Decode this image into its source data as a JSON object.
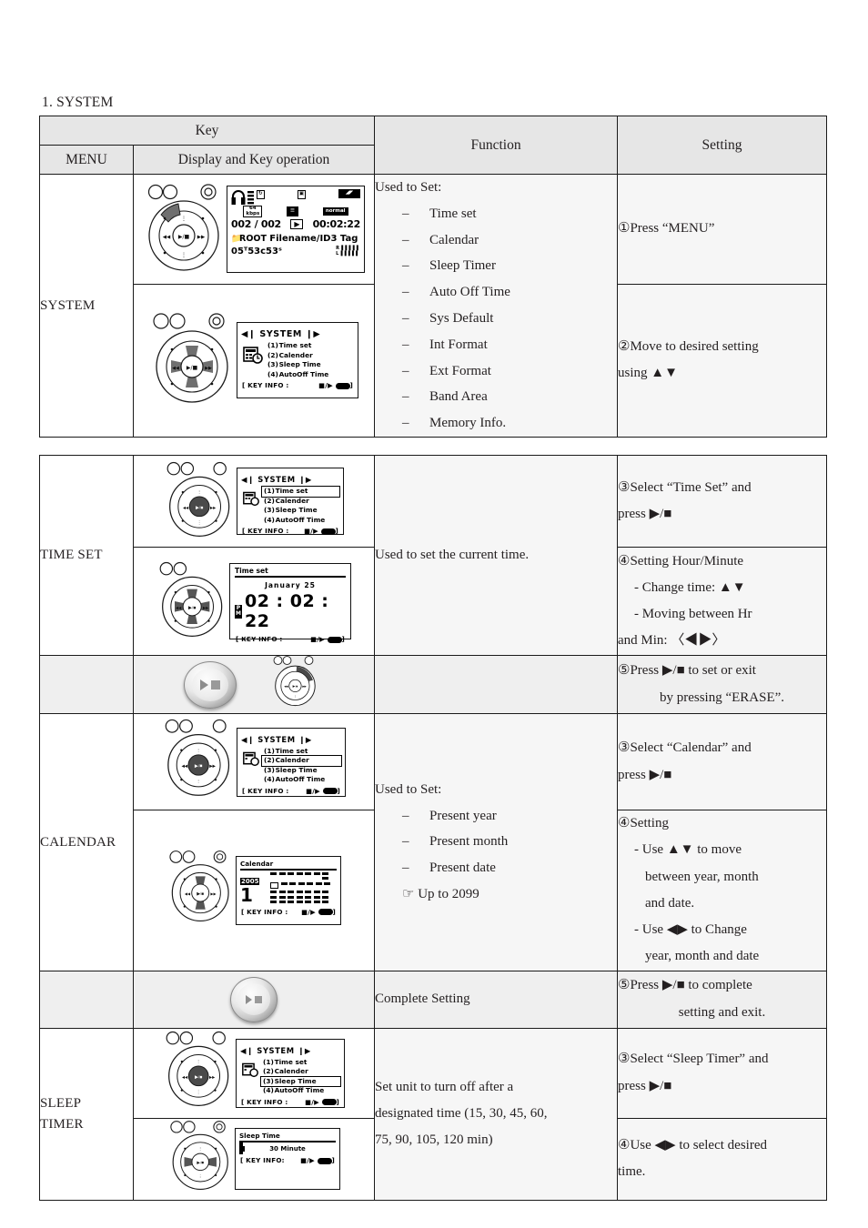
{
  "page": {
    "section_title": "1. SYSTEM"
  },
  "table": {
    "headers": {
      "key": "Key",
      "menu": "MENU",
      "display": "Display and Key operation",
      "function": "Function",
      "setting": "Setting"
    }
  },
  "rows": {
    "system": {
      "menu": "SYSTEM",
      "function_intro": "Used to Set:",
      "function_items": [
        "Time set",
        "Calendar",
        "Sleep Timer",
        "Auto Off Time",
        "Sys Default",
        "Int Format",
        "Ext Format",
        "Band Area",
        "Memory Info."
      ],
      "setting_1": "①Press “MENU”",
      "setting_2_a": "②Move to desired setting",
      "setting_2_b": "using ▲▼"
    },
    "time_set": {
      "menu": "TIME SET",
      "function": "Used to set the current time.",
      "setting_3_a": "③Select  “Time  Set”  and",
      "setting_3_b": "press ▶/■",
      "setting_4_title": "④Setting Hour/Minute",
      "setting_4_l1": "- Change time: ▲▼",
      "setting_4_l2": "-  Moving  between  Hr",
      "setting_4_l3": "and Min: 〈◀▶〉",
      "setting_5_a": "⑤Press ▶/■ to set or exit",
      "setting_5_b": "by pressing “ERASE”."
    },
    "calendar": {
      "menu": "CALENDAR",
      "function_intro": "Used to Set:",
      "function_items": [
        "Present year",
        "Present month",
        "Present date"
      ],
      "function_note": "☞ Up to 2099",
      "setting_3_a": "③Select  “Calendar”  and",
      "setting_3_b": "press ▶/■",
      "setting_4_title": "④Setting",
      "setting_4_l1": "-  Use  ▲▼  to  move",
      "setting_4_l2": "between year, month",
      "setting_4_l3": "and date.",
      "setting_4_l4": "-  Use  ◀▶  to  Change",
      "setting_4_l5": "year, month and date",
      "complete_function": "Complete Setting",
      "setting_5_a": "⑤Press ▶/■ to complete",
      "setting_5_b": "setting and exit."
    },
    "sleep_timer": {
      "menu_l1": "SLEEP",
      "menu_l2": "TIMER",
      "function_a": "Set  unit  to  turn  off  after  a",
      "function_b": "designated time (15, 30, 45, 60,",
      "function_c": "75, 90, 105, 120 min)",
      "setting_3_a": "③Select “Sleep Timer” and",
      "setting_3_b": "press ▶/■",
      "setting_4_a": "④Use ◀▶ to select desired",
      "setting_4_b": "time."
    }
  },
  "lcd": {
    "play_screen": {
      "track": "002 / 002",
      "time": "00:02:22",
      "folder": "ROOT",
      "filename": "Filename/ID3 Tag",
      "remaining": "05ᵀ53ᴄ53ˢ",
      "bitrate": "64",
      "bitrate_unit": "kbps",
      "eq_mode": "normal",
      "channel_r": "R",
      "channel_l": "L"
    },
    "system_menu": {
      "title": "SYSTEM",
      "items": [
        {
          "num": "(1)",
          "label": "Time set"
        },
        {
          "num": "(2)",
          "label": "Calender"
        },
        {
          "num": "(3)",
          "label": "Sleep Time"
        },
        {
          "num": "(4)",
          "label": "AutoOff Time"
        }
      ],
      "keyinfo_label": "[ KEY INFO :",
      "keyinfo_keys": "■/▶",
      "keyinfo_close": "]"
    },
    "time_set_screen": {
      "title": "Time set",
      "date": "January   25",
      "meridiem_p": "P",
      "meridiem_m": "M",
      "digits": "02 : 02 : 22",
      "keyinfo_label": "[ KEY INFO :",
      "keyinfo_keys": "■/▶"
    },
    "calendar_screen": {
      "title": "Calendar",
      "year": "2005",
      "day": "1",
      "keyinfo_label": "[ KEY INFO :",
      "keyinfo_keys": "■/▶"
    },
    "sleep_screen": {
      "title": "Sleep Time",
      "value": "30 Minute",
      "keyinfo_label": "[ KEY INFO:",
      "keyinfo_keys": "■/▶"
    }
  },
  "colors": {
    "header_bg": "#e6e6e6",
    "cell_bg": "#f6f6f6",
    "shaded_bg": "#efefef",
    "border": "#1a1a1a",
    "text": "#231f20"
  }
}
